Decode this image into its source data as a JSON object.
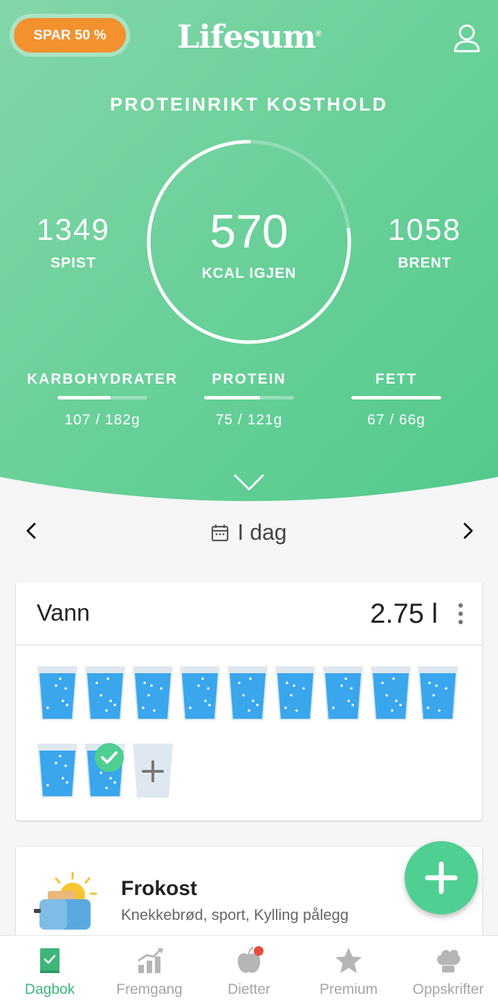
{
  "header": {
    "promo_label": "SPAR 50 %",
    "logo": "Lifesum",
    "diet_title": "PROTEINRIKT KOSTHOLD"
  },
  "calories": {
    "eaten_value": "1349",
    "eaten_label": "SPIST",
    "remaining_value": "570",
    "remaining_label": "KCAL IGJEN",
    "burned_value": "1058",
    "burned_label": "BRENT",
    "ring_progress": 0.77
  },
  "macros": [
    {
      "name": "KARBOHYDRATER",
      "value": "107 / 182g",
      "progress": 0.59
    },
    {
      "name": "PROTEIN",
      "value": "75 / 121g",
      "progress": 0.62
    },
    {
      "name": "FETT",
      "value": "67 / 66g",
      "progress": 1.0
    }
  ],
  "date_nav": {
    "label": "I dag"
  },
  "water": {
    "title": "Vann",
    "amount": "2.75 l",
    "glasses_filled": 11,
    "glass_checked_index": 10
  },
  "meal": {
    "title": "Frokost",
    "items": "Knekkebrød, sport, Kylling pålegg"
  },
  "bottom_nav": [
    {
      "label": "Dagbok",
      "icon": "diary-icon",
      "active": true
    },
    {
      "label": "Fremgang",
      "icon": "progress-chart-icon",
      "active": false
    },
    {
      "label": "Dietter",
      "icon": "apple-icon",
      "active": false
    },
    {
      "label": "Premium",
      "icon": "star-icon",
      "active": false
    },
    {
      "label": "Oppskrifter",
      "icon": "chef-hat-icon",
      "active": false
    }
  ],
  "colors": {
    "brand_green": "#5fcd93",
    "promo_orange": "#f4912f",
    "water_blue": "#3aa6ec",
    "active_nav": "#3fb57a"
  }
}
